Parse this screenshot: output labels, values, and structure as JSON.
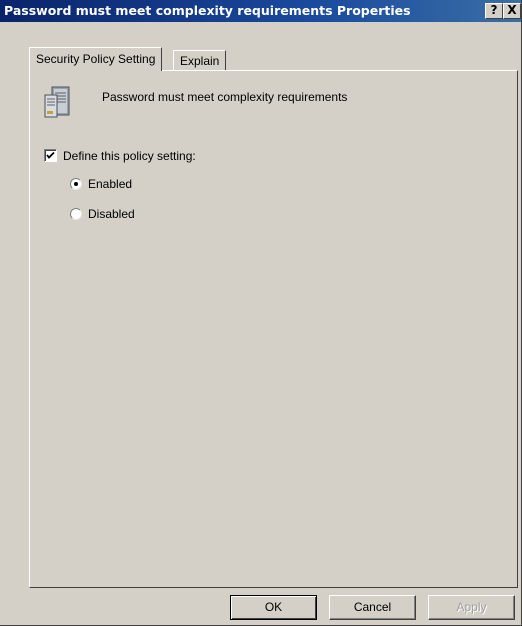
{
  "window": {
    "title": "Password must meet complexity requirements Properties",
    "help_glyph": "?",
    "close_glyph": "X"
  },
  "tabs": [
    {
      "label": "Security Policy Setting",
      "active": true
    },
    {
      "label": "Explain",
      "active": false
    }
  ],
  "policy": {
    "icon": "server-policy-icon",
    "name": "Password must meet complexity requirements"
  },
  "define_setting": {
    "label": "Define this policy setting:",
    "checked": true
  },
  "options": [
    {
      "label": "Enabled",
      "selected": true
    },
    {
      "label": "Disabled",
      "selected": false
    }
  ],
  "buttons": {
    "ok": "OK",
    "cancel": "Cancel",
    "apply": "Apply",
    "apply_enabled": false
  },
  "colors": {
    "title_bar": "#0a246a",
    "dialog_face": "#d4d0c8"
  }
}
